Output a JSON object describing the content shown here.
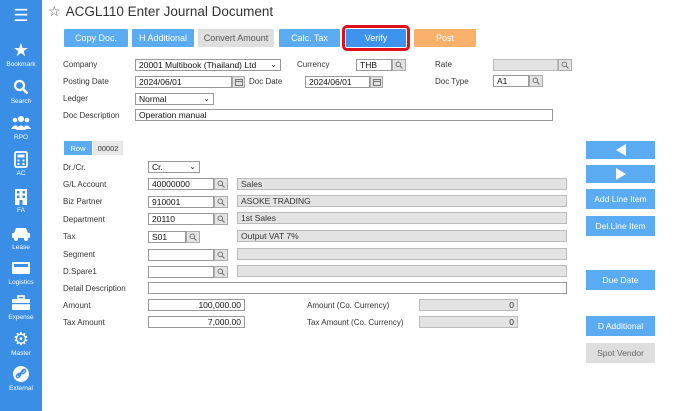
{
  "sidebar": {
    "items": [
      {
        "label": "Bookmark",
        "icon": "star-icon"
      },
      {
        "label": "Search",
        "icon": "search-icon"
      },
      {
        "label": "RPO",
        "icon": "users-icon"
      },
      {
        "label": "AC",
        "icon": "calculator-icon"
      },
      {
        "label": "FA",
        "icon": "building-icon"
      },
      {
        "label": "Lease",
        "icon": "car-icon"
      },
      {
        "label": "Logistics",
        "icon": "truck-icon"
      },
      {
        "label": "Expense",
        "icon": "briefcase-icon"
      },
      {
        "label": "Master",
        "icon": "gear-icon"
      },
      {
        "label": "External",
        "icon": "link-icon"
      }
    ]
  },
  "header": {
    "title": "ACGL110 Enter Journal Document"
  },
  "toolbar": {
    "copy_doc": "Copy Doc.",
    "h_additional": "H Additional",
    "convert_amount": "Convert Amount",
    "calc_tax": "Calc. Tax",
    "verify": "Verify",
    "post": "Post"
  },
  "header_form": {
    "company_label": "Company",
    "company_value": "20001 Multibook (Thailand) Ltd",
    "currency_label": "Currency",
    "currency_value": "THB",
    "rate_label": "Rate",
    "rate_value": "",
    "posting_date_label": "Posting Date",
    "posting_date_value": "2024/06/01",
    "doc_date_label": "Doc Date",
    "doc_date_value": "2024/06/01",
    "doc_type_label": "Doc Type",
    "doc_type_value": "A1",
    "ledger_label": "Ledger",
    "ledger_value": "Normal",
    "doc_description_label": "Doc Description",
    "doc_description_value": "Operation manual"
  },
  "row_tabs": {
    "row_label": "Row",
    "row_number": "00002"
  },
  "line_form": {
    "drcr_label": "Dr./Cr.",
    "drcr_value": "Cr.",
    "gl_account_label": "G/L Account",
    "gl_account_value": "40000000",
    "gl_account_name": "Sales",
    "biz_partner_label": "Biz Partner",
    "biz_partner_value": "910001",
    "biz_partner_name": "ASOKE TRADING",
    "department_label": "Department",
    "department_value": "20110",
    "department_name": "1st Sales",
    "tax_label": "Tax",
    "tax_value": "S01",
    "tax_name": "Output VAT 7%",
    "segment_label": "Segment",
    "segment_value": "",
    "dspare1_label": "D.Spare1",
    "dspare1_value": "",
    "detail_description_label": "Detail Description",
    "detail_description_value": "",
    "amount_label": "Amount",
    "amount_value": "100,000.00",
    "amount_cc_label": "Amount (Co. Currency)",
    "amount_cc_value": "0",
    "tax_amount_label": "Tax Amount",
    "tax_amount_value": "7,000.00",
    "tax_amount_cc_label": "Tax Amount (Co. Currency)",
    "tax_amount_cc_value": "0"
  },
  "side_buttons": {
    "add_line_item": "Add Line Item",
    "del_line_item": "Del.Line Item",
    "due_date": "Due Date",
    "d_additional": "D Additional",
    "spot_vendor": "Spot Vendor"
  }
}
